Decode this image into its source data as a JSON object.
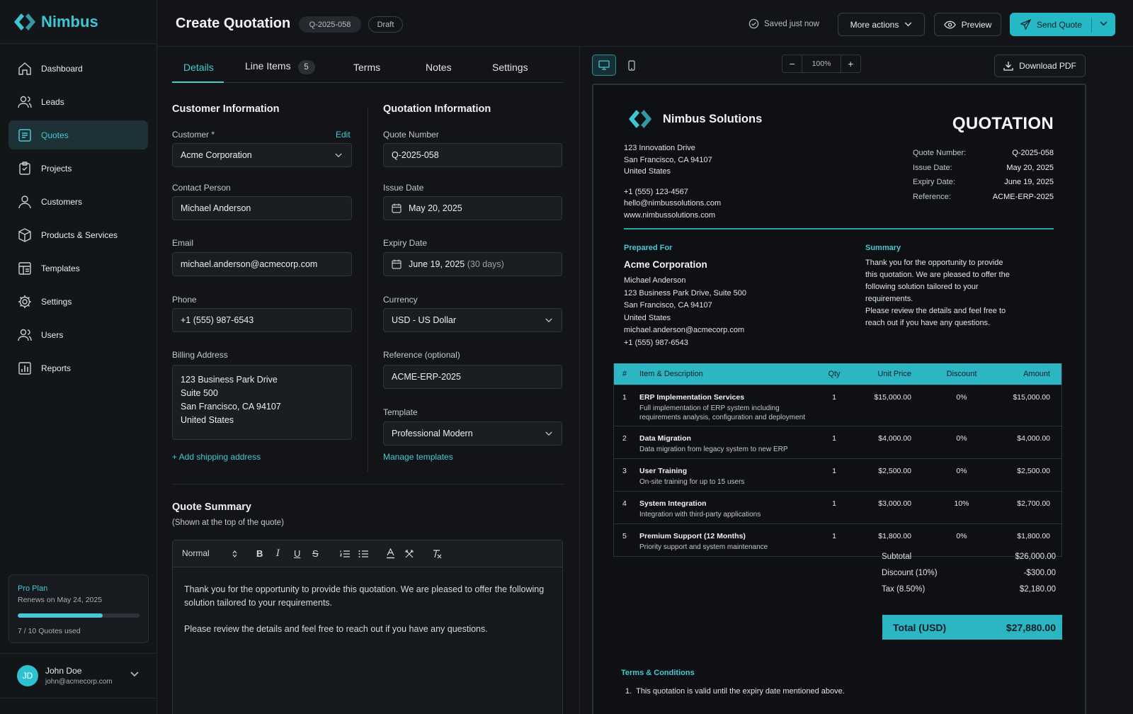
{
  "app": {
    "name": "Nimbus"
  },
  "sidebar": {
    "items": [
      {
        "label": "Dashboard",
        "icon": "home-icon"
      },
      {
        "label": "Leads",
        "icon": "users-icon"
      },
      {
        "label": "Quotes",
        "icon": "quote-doc-icon",
        "active": true
      },
      {
        "label": "Projects",
        "icon": "clipboard-icon"
      },
      {
        "label": "Customers",
        "icon": "customers-icon"
      },
      {
        "label": "Products & Services",
        "icon": "box-icon"
      },
      {
        "label": "Templates",
        "icon": "template-icon"
      },
      {
        "label": "Settings",
        "icon": "gear-icon"
      },
      {
        "label": "Users",
        "icon": "user-group-icon"
      },
      {
        "label": "Reports",
        "icon": "chart-icon"
      }
    ],
    "plan": {
      "name": "Pro Plan",
      "renews": "Renews on May 24, 2025",
      "used_label": "7 / 10 Quotes used",
      "used": 7,
      "total": 10
    },
    "user": {
      "initials": "JD",
      "name": "John Doe",
      "email": "john@acmecorp.com"
    }
  },
  "header": {
    "title": "Create Quotation",
    "quote_number": "Q-2025-058",
    "status": "Draft",
    "saved": "Saved just now",
    "more_actions": "More actions",
    "preview": "Preview",
    "send": "Send Quote"
  },
  "tabs": {
    "details": "Details",
    "line_items": "Line Items",
    "line_items_count": "5",
    "terms": "Terms",
    "notes": "Notes",
    "settings": "Settings"
  },
  "customer": {
    "title": "Customer Information",
    "customer_label": "Customer *",
    "edit": "Edit",
    "customer": "Acme Corporation",
    "contact_label": "Contact Person",
    "contact": "Michael Anderson",
    "email_label": "Email",
    "email": "michael.anderson@acmecorp.com",
    "phone_label": "Phone",
    "phone": "+1 (555) 987-6543",
    "billing_label": "Billing Address",
    "billing": [
      "123 Business Park Drive",
      "Suite 500",
      "San Francisco, CA 94107",
      "United States"
    ],
    "add_shipping": "+ Add shipping address"
  },
  "quotation": {
    "title": "Quotation Information",
    "number_label": "Quote Number",
    "number": "Q-2025-058",
    "issue_label": "Issue Date",
    "issue": "May 20, 2025",
    "expiry_label": "Expiry Date",
    "expiry": "June 19, 2025",
    "expiry_note": "(30 days)",
    "currency_label": "Currency",
    "currency": "USD - US Dollar",
    "reference_label": "Reference (optional)",
    "reference": "ACME-ERP-2025",
    "template_label": "Template",
    "template": "Professional Modern",
    "manage": "Manage templates"
  },
  "summary": {
    "title": "Quote Summary",
    "hint": "(Shown at the top of the quote)",
    "format": "Normal",
    "p1": "Thank you for the opportunity to provide this quotation. We are pleased to offer the following solution tailored to your requirements.",
    "p2": "Please review the details and feel free to reach out if you have any questions."
  },
  "preview": {
    "zoom": "100%",
    "download": "Download PDF",
    "company": "Nimbus Solutions",
    "doc_title": "QUOTATION",
    "address": [
      "123 Innovation Drive",
      "San Francisco, CA 94107",
      "United States"
    ],
    "contact": [
      "+1 (555) 123-4567",
      "hello@nimbussolutions.com",
      "www.nimbussolutions.com"
    ],
    "meta": [
      {
        "k": "Quote Number:",
        "v": "Q-2025-058"
      },
      {
        "k": "Issue Date:",
        "v": "May 20, 2025"
      },
      {
        "k": "Expiry Date:",
        "v": "June 19, 2025"
      },
      {
        "k": "Reference:",
        "v": "ACME-ERP-2025"
      }
    ],
    "prepared_for": "Prepared For",
    "client": "Acme Corporation",
    "client_lines": [
      "Michael Anderson",
      "123 Business Park Drive, Suite 500",
      "San Francisco, CA 94107",
      "United States",
      "michael.anderson@acmecorp.com",
      "+1 (555) 987-6543"
    ],
    "summary_title": "Summary",
    "summary_lines": [
      "Thank you for the opportunity to provide",
      "this quotation. We are pleased to offer the",
      "following solution tailored to your",
      "requirements.",
      "Please review the details and feel free to",
      "reach out if you have any questions."
    ],
    "table": {
      "headers": {
        "no": "#",
        "item": "Item & Description",
        "qty": "Qty",
        "price": "Unit Price",
        "disc": "Discount",
        "amt": "Amount"
      },
      "rows": [
        {
          "no": "1",
          "title": "ERP Implementation Services",
          "desc": [
            "Full implementation of ERP system including",
            "requirements analysis, configuration and deployment"
          ],
          "qty": "1",
          "price": "$15,000.00",
          "disc": "0%",
          "amt": "$15,000.00"
        },
        {
          "no": "2",
          "title": "Data Migration",
          "desc": [
            "Data migration from legacy system to new ERP"
          ],
          "qty": "1",
          "price": "$4,000.00",
          "disc": "0%",
          "amt": "$4,000.00"
        },
        {
          "no": "3",
          "title": "User Training",
          "desc": [
            "On-site training for up to 15 users"
          ],
          "qty": "1",
          "price": "$2,500.00",
          "disc": "0%",
          "amt": "$2,500.00"
        },
        {
          "no": "4",
          "title": "System Integration",
          "desc": [
            "Integration with third-party applications"
          ],
          "qty": "1",
          "price": "$3,000.00",
          "disc": "10%",
          "amt": "$2,700.00"
        },
        {
          "no": "5",
          "title": "Premium Support (12 Months)",
          "desc": [
            "Priority support and system maintenance"
          ],
          "qty": "1",
          "price": "$1,800.00",
          "disc": "0%",
          "amt": "$1,800.00"
        }
      ]
    },
    "totals": [
      {
        "k": "Subtotal",
        "v": "$26,000.00"
      },
      {
        "k": "Discount (10%)",
        "v": "-$300.00"
      },
      {
        "k": "Tax (8.50%)",
        "v": "$2,180.00"
      }
    ],
    "total_label": "Total (USD)",
    "total": "$27,880.00",
    "terms_title": "Terms & Conditions",
    "terms": [
      "This quotation is valid until the expiry date mentioned above."
    ]
  },
  "colors": {
    "accent": "#2cb5c2",
    "background": "#121417",
    "panel": "#1a1d21"
  }
}
